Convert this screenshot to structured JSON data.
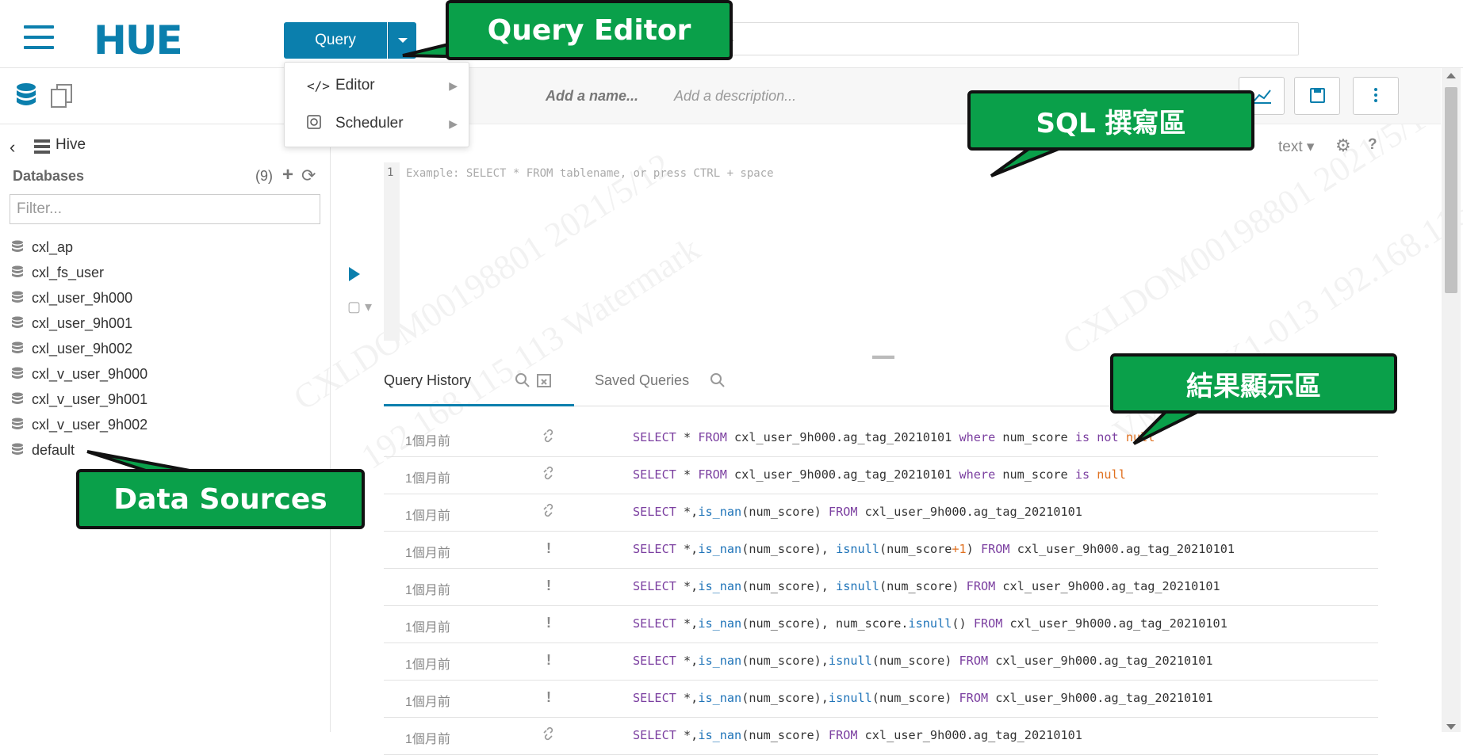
{
  "topbar": {
    "query_button": "Query",
    "search_placeholder": "..."
  },
  "dropdown": {
    "items": [
      {
        "icon": "code-icon",
        "label": "Editor"
      },
      {
        "icon": "scheduler-icon",
        "label": "Scheduler"
      }
    ]
  },
  "left": {
    "source": "Hive",
    "databases_label": "Databases",
    "count": "(9)",
    "filter_placeholder": "Filter...",
    "databases": [
      "cxl_ap",
      "cxl_fs_user",
      "cxl_user_9h000",
      "cxl_user_9h001",
      "cxl_user_9h002",
      "cxl_v_user_9h000",
      "cxl_v_user_9h001",
      "cxl_v_user_9h002",
      "default"
    ]
  },
  "editor": {
    "add_name": "Add a name...",
    "add_description": "Add a description...",
    "type_selector": "text",
    "line_number": "1",
    "placeholder": "Example: SELECT * FROM tablename, or press CTRL + space"
  },
  "results": {
    "tab_history": "Query History",
    "tab_saved": "Saved Queries",
    "history": [
      {
        "time": "1個月前",
        "status": "success",
        "sql": "SELECT * FROM cxl_user_9h000.ag_tag_20210101 where num_score is not null"
      },
      {
        "time": "1個月前",
        "status": "success",
        "sql": "SELECT * FROM cxl_user_9h000.ag_tag_20210101 where num_score is null"
      },
      {
        "time": "1個月前",
        "status": "success",
        "sql": "SELECT *,is_nan(num_score) FROM cxl_user_9h000.ag_tag_20210101"
      },
      {
        "time": "1個月前",
        "status": "error",
        "sql": "SELECT *,is_nan(num_score), isnull(num_score+1) FROM cxl_user_9h000.ag_tag_20210101"
      },
      {
        "time": "1個月前",
        "status": "error",
        "sql": "SELECT *,is_nan(num_score), isnull(num_score) FROM cxl_user_9h000.ag_tag_20210101"
      },
      {
        "time": "1個月前",
        "status": "error",
        "sql": "SELECT *,is_nan(num_score), num_score.isnull() FROM cxl_user_9h000.ag_tag_20210101"
      },
      {
        "time": "1個月前",
        "status": "error",
        "sql": "SELECT *,is_nan(num_score),isnull(num_score) FROM cxl_user_9h000.ag_tag_20210101"
      },
      {
        "time": "1個月前",
        "status": "error",
        "sql": "SELECT *,is_nan(num_score),isnull(num_score) FROM cxl_user_9h000.ag_tag_20210101"
      },
      {
        "time": "1個月前",
        "status": "success",
        "sql": "SELECT *,is_nan(num_score) FROM cxl_user_9h000.ag_tag_20210101"
      }
    ]
  },
  "annotations": {
    "query_editor": "Query Editor",
    "sql_area": "SQL 撰寫區",
    "results_area": "結果顯示區",
    "data_sources": "Data Sources"
  },
  "colors": {
    "brand": "#0B7FAD",
    "callout": "#0AA04A"
  }
}
